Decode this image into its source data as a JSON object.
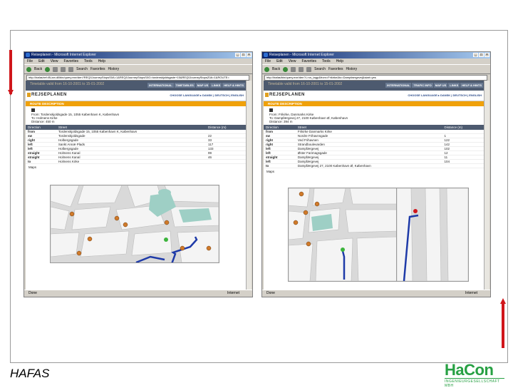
{
  "slide": {
    "footer_label": "HAFAS",
    "logo": {
      "word": "HaCon",
      "tagline": "INGENIEURGESELLSCHAFT MBH",
      "color": "#27a043"
    },
    "accent": "#d0161b"
  },
  "windows": [
    {
      "title": "Reiseplanen - Microsoft Internet Explorer",
      "menu": [
        "File",
        "Edit",
        "View",
        "Favorites",
        "Tools",
        "Help"
      ],
      "toolbar": {
        "back": "Back",
        "search": "Search",
        "favorites": "Favorites",
        "history": "History"
      },
      "address": "http://hafas/ref=BLsrv.dll/bin/query.exe/den?REQ0JourneyStopsS0A=1&REQ0JourneyStopsS0G=tordenskjoldsgade+15&REQ0JourneyStopsZ0A=1&ROUTE=",
      "status": "Done",
      "zone": "Internet",
      "site": {
        "timetable": "Timetable valid from 16-10-2001 to 15-01-2002",
        "nav": [
          "INTERNATIONAL",
          "TIMETABLES",
          "MAP US",
          "LINKS",
          "HELP & HINTS"
        ],
        "brand": "REJSEPLANEN",
        "languages": "CHOOSE LANGUAGE ▸ DANSK | DEUTSCH | ENGLISH",
        "section": "ROUTE DESCRIPTION",
        "from_lines": [
          "From: Tordenskjoldsgade 15, 1055 København K, København",
          "To: Holmens Kirke",
          "Distance: 450 m"
        ],
        "columns": [
          "Direction",
          "Street",
          "Distance (m)"
        ],
        "rows": [
          {
            "dir": "from",
            "street": "Tordenskjoldsgade 15, 1055 København K, København",
            "dist": ""
          },
          {
            "dir": "sw",
            "street": "Tordenskjoldsgade",
            "dist": "22"
          },
          {
            "dir": "right",
            "street": "Holbergsgade",
            "dist": "33"
          },
          {
            "dir": "left",
            "street": "Sankt Annæ Plads",
            "dist": "117"
          },
          {
            "dir": "left",
            "street": "Holbergsgade",
            "dist": "133"
          },
          {
            "dir": "straight",
            "street": "Holmens Kanal",
            "dist": "99"
          },
          {
            "dir": "straight",
            "street": "Holmens Kanal",
            "dist": "46"
          },
          {
            "dir": "to",
            "street": "Holmens Kirke",
            "dist": ""
          }
        ],
        "maps_label": "Maps"
      }
    },
    {
      "title": "Reiseplanen - Microsoft Internet Explorer",
      "menu": [
        "File",
        "Edit",
        "View",
        "Favorites",
        "Tools",
        "Help"
      ],
      "toolbar": {
        "back": "Back",
        "search": "Search",
        "favorites": "Favorites",
        "history": "History"
      },
      "address": "http://hafas/bin/query.exe/den?L=vs_tagp&from=Frikirke&to=Dampfaergevej&start=yes",
      "status": "Done",
      "zone": "Internet",
      "site": {
        "timetable": "Timetable valid from 16-10-2001 to 15-01-2002",
        "nav": [
          "INTERNATIONAL",
          "TRAFIC INFO",
          "MAP US",
          "LINKS",
          "HELP & HINTS"
        ],
        "brand": "REJSEPLANEN",
        "languages": "CHOOSE LANGUAGE ▸ DANSK | DEUTSCH | ENGLISH",
        "section": "ROUTE DESCRIPTION",
        "from_lines": [
          "From: Frikirke, Danmarks Kirke",
          "To: Dampfærgevej 27, 2100 København Ø, København",
          "Distance: 394 m"
        ],
        "columns": [
          "Direction",
          "Street",
          "Distance (m)"
        ],
        "rows": [
          {
            "dir": "from",
            "street": "Frikirke Danmarks Kirke",
            "dist": ""
          },
          {
            "dir": "sw",
            "street": "Nordre Frihavnsgade",
            "dist": "1"
          },
          {
            "dir": "right",
            "street": "Ved Frihavnen",
            "dist": "122"
          },
          {
            "dir": "right",
            "street": "Strandboulevarden",
            "dist": "142"
          },
          {
            "dir": "left",
            "street": "Dampfærgevej",
            "dist": "102"
          },
          {
            "dir": "left",
            "street": "Øster Farimagsgade",
            "dist": "12"
          },
          {
            "dir": "straight",
            "street": "Dampfærgevej",
            "dist": "11"
          },
          {
            "dir": "left",
            "street": "Dampfærgevej",
            "dist": "104"
          },
          {
            "dir": "to",
            "street": "Dampfærgevej 27, 2100 København Ø, København",
            "dist": ""
          }
        ],
        "maps_label": "Maps"
      }
    }
  ]
}
